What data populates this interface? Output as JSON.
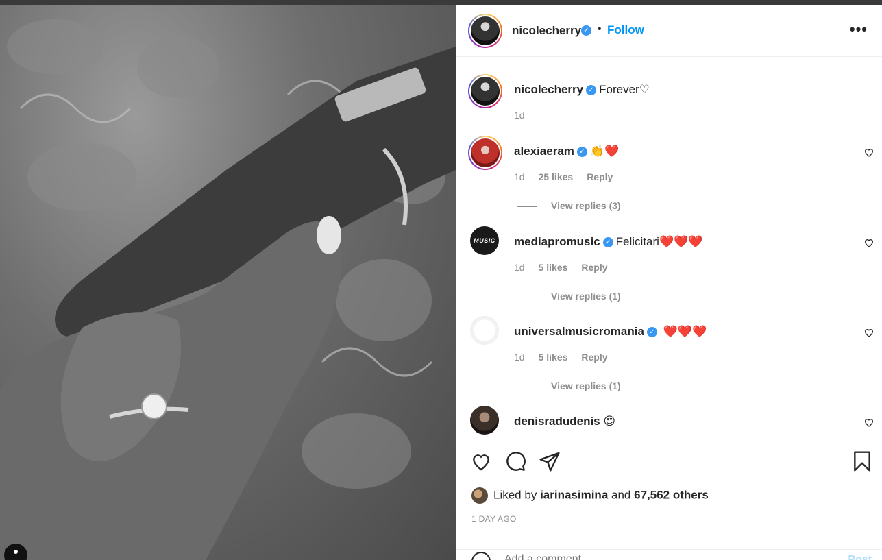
{
  "header": {
    "username": "nicolecherry",
    "separator": "•",
    "follow_label": "Follow",
    "more_label": "•••"
  },
  "caption": {
    "username": "nicolecherry",
    "text": "Forever♡",
    "time": "1d"
  },
  "comments": [
    {
      "username": "alexiaeram",
      "text": "👏❤️",
      "time": "1d",
      "likes": "25 likes",
      "reply": "Reply",
      "view_replies": "View replies (3)"
    },
    {
      "username": "mediapromusic",
      "text": "Felicitari❤️❤️❤️",
      "time": "1d",
      "likes": "5 likes",
      "reply": "Reply",
      "view_replies": "View replies (1)",
      "avatar_text": "MUSIC"
    },
    {
      "username": "universalmusicromania",
      "text": " ❤️❤️❤️",
      "time": "1d",
      "likes": "5 likes",
      "reply": "Reply",
      "view_replies": "View replies (1)"
    },
    {
      "username": "denisradudenis",
      "text": " 😍"
    }
  ],
  "likes": {
    "prefix": "Liked by",
    "user": "iarinasimina",
    "conj": "and",
    "others": "67,562 others"
  },
  "time_ago": "1 DAY AGO",
  "add_comment": {
    "placeholder": "Add a comment...",
    "post_label": "Post"
  },
  "icons": [
    "heart-icon",
    "comment-icon",
    "share-icon",
    "bookmark-icon",
    "verified-icon",
    "more-icon",
    "emoji-icon"
  ],
  "colors": {
    "accent": "#0095f6",
    "verified": "#3897f0",
    "heart": "#e01b24",
    "post_disabled": "#b2dffc"
  }
}
